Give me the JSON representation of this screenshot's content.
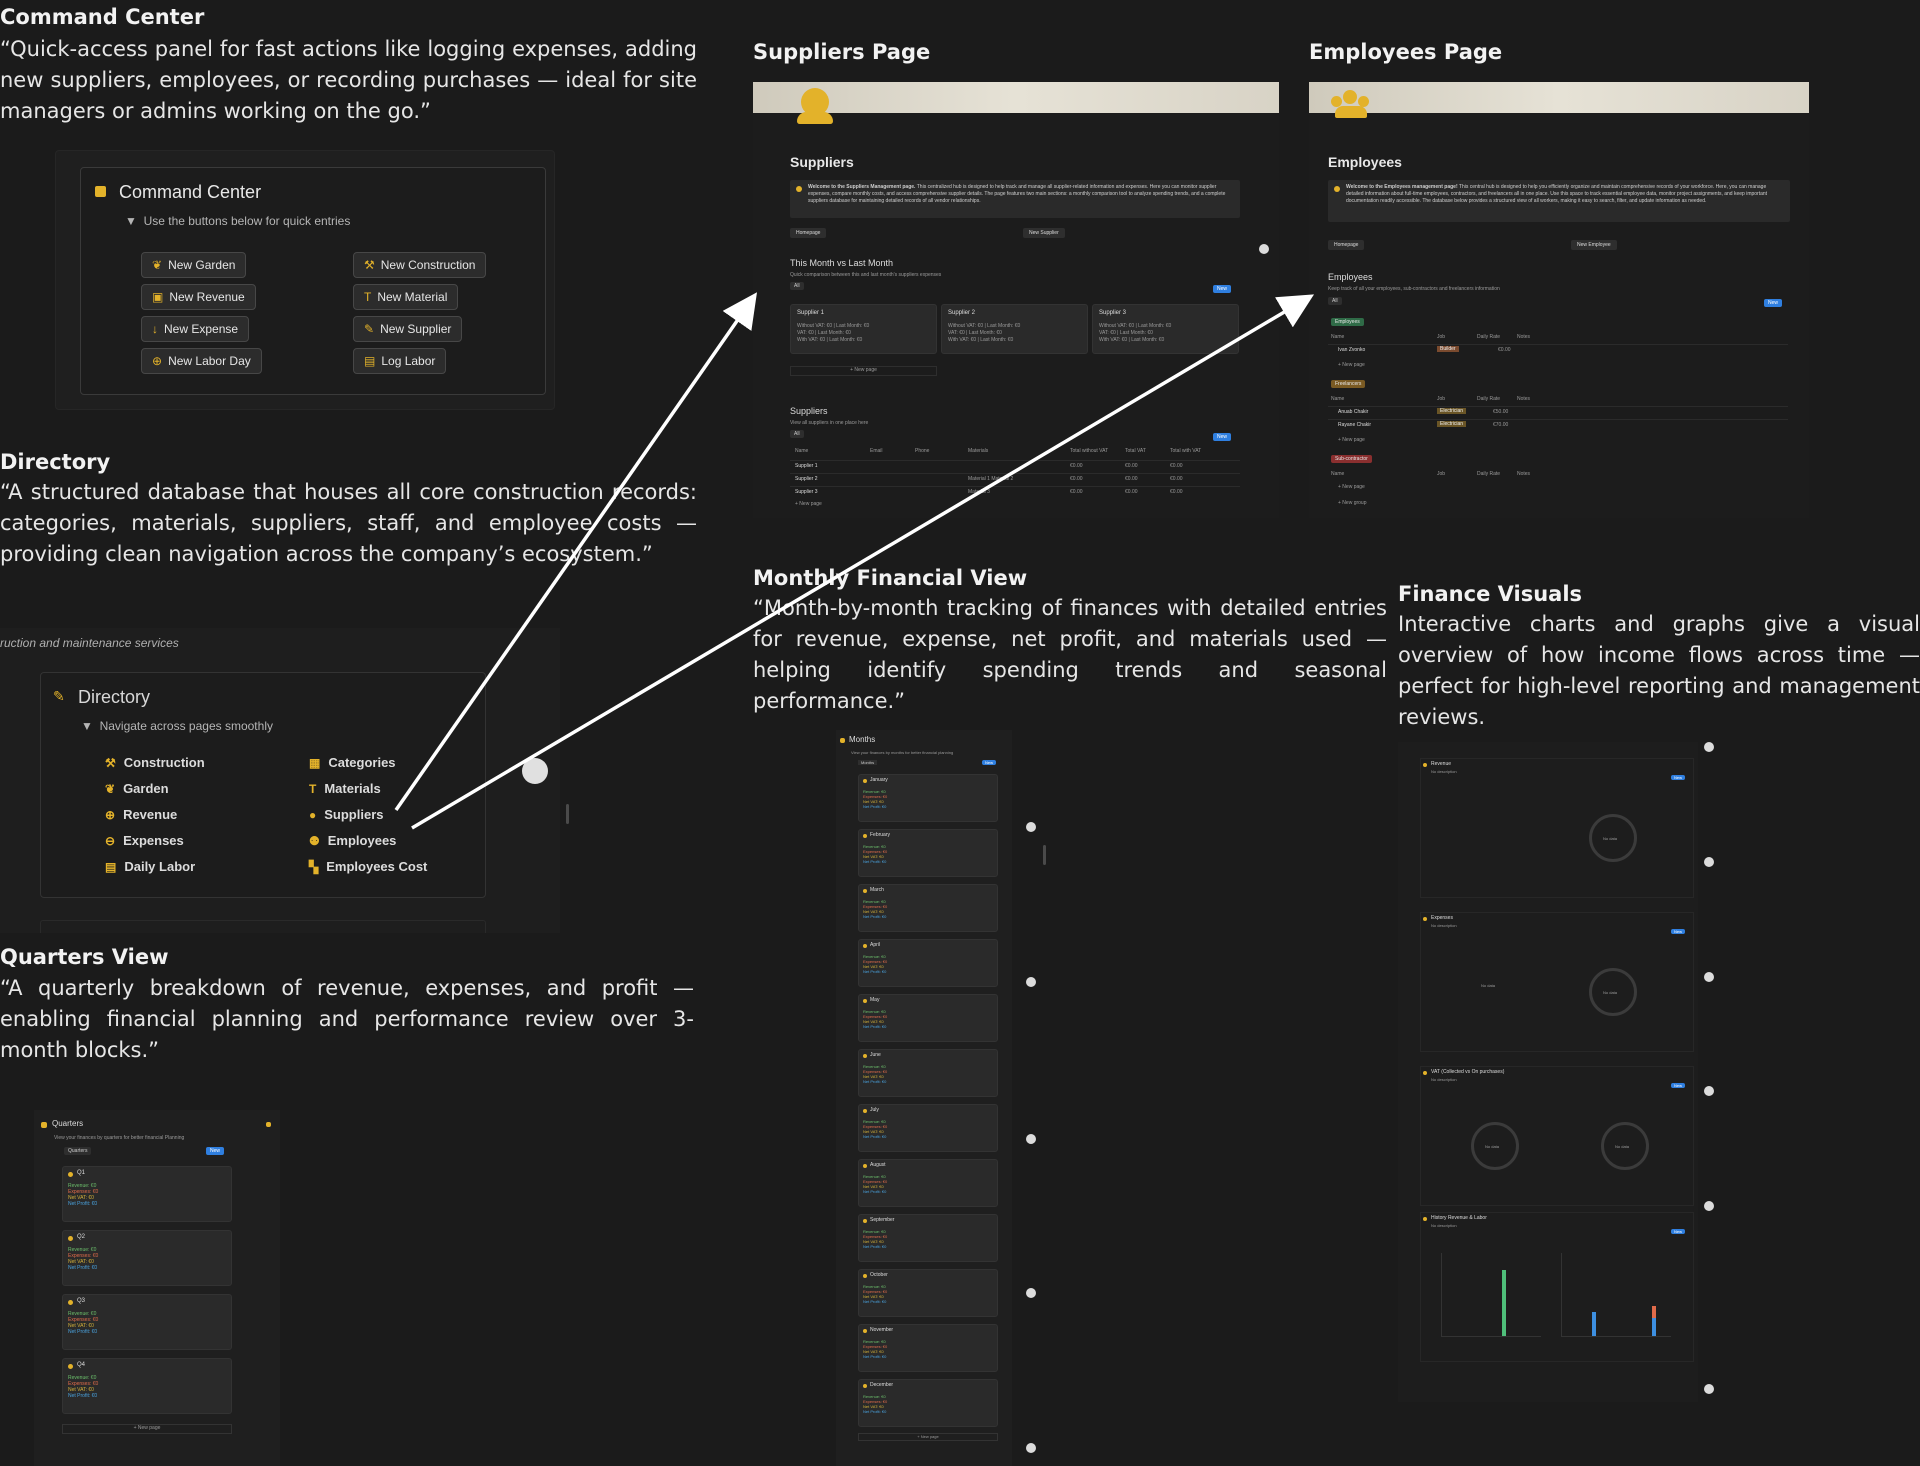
{
  "command_center": {
    "title": "Command Center",
    "description": "“Quick-access panel for fast actions like logging expenses, adding new suppliers, employees, or recording purchases — ideal for site managers or admins working on the go.”",
    "panel_title": "Command Center",
    "hint": "Use the buttons below for quick entries",
    "buttons": {
      "new_garden": "New Garden",
      "new_construction": "New Construction",
      "new_revenue": "New Revenue",
      "new_material": "New Material",
      "new_expense": "New Expense",
      "new_supplier": "New Supplier",
      "new_labor_day": "New Labor Day",
      "log_labor": "Log Labor"
    }
  },
  "directory": {
    "title": "Directory",
    "description": "“A structured database that houses all core construction records: categories, materials, suppliers, staff, and employee costs — providing clean navigation across the company’s ecosystem.”",
    "cut_header": "ruction and maintenance services",
    "panel_title": "Directory",
    "hint": "Navigate across pages smoothly",
    "items": {
      "construction": "Construction",
      "garden": "Garden",
      "revenue": "Revenue",
      "expenses": "Expenses",
      "daily_labor": "Daily Labor",
      "categories": "Categories",
      "materials": "Materials",
      "suppliers": "Suppliers",
      "employees": "Employees",
      "employees_cost": "Employees Cost"
    }
  },
  "quarters": {
    "title": "Quarters View",
    "description": "“A quarterly breakdown of revenue, expenses, and profit — enabling financial planning and performance review over 3-month blocks.”",
    "panel_title": "Quarters",
    "hint": "View your finances by quarters for better financial Planning",
    "tab": "Quarters",
    "new": "New",
    "cards": [
      "Q1",
      "Q2",
      "Q3",
      "Q4"
    ],
    "new_page": "+ New page"
  },
  "suppliers_page": {
    "title": "Suppliers Page",
    "heading": "Suppliers",
    "welcome_bold": "Welcome to the Suppliers Management page.",
    "welcome_rest": "This centralized hub is designed to help track and manage all supplier-related information and expenses. Here you can monitor supplier expenses, compare monthly costs, and access comprehensive supplier details. The page features two main sections: a monthly comparison tool to analyze spending trends, and a complete suppliers database for maintaining detailed records of all vendor relationships.",
    "homepage_btn": "Homepage",
    "new_supplier_btn": "New Supplier",
    "compare_title": "This Month vs Last Month",
    "compare_sub": "Quick comparison between this and last month's suppliers expenses",
    "all_tab": "All",
    "new": "New",
    "supplier_cards": [
      "Supplier 1",
      "Supplier 2",
      "Supplier 3"
    ],
    "card_line1": "Without VAT: €0 | Last Month: €0",
    "card_line2": "VAT: €0 | Last Month: €0",
    "card_line3": "With VAT: €0 | Last Month: €0",
    "new_page": "+ New page",
    "list_title": "Suppliers",
    "list_sub": "View all suppliers in one place here",
    "columns": [
      "Name",
      "Email",
      "Phone",
      "Materials",
      "Total without VAT",
      "Total VAT",
      "Total with VAT"
    ],
    "rows": [
      {
        "name": "Supplier 1",
        "materials": "",
        "t1": "€0.00",
        "t2": "€0.00",
        "t3": "€0.00"
      },
      {
        "name": "Supplier 2",
        "materials": "Material 1  Material 2",
        "t1": "€0.00",
        "t2": "€0.00",
        "t3": "€0.00"
      },
      {
        "name": "Supplier 3",
        "materials": "Material 3",
        "t1": "€0.00",
        "t2": "€0.00",
        "t3": "€0.00"
      }
    ]
  },
  "employees_page": {
    "title": "Employees Page",
    "heading": "Employees",
    "welcome_bold": "Welcome to the Employees management page!",
    "welcome_rest": "This central hub is designed to help you efficiently organize and maintain comprehensive records of your workforce. Here, you can manage detailed information about full-time employees, contractors, and freelancers all in one place. Use this space to track essential employee data, monitor project assignments, and keep important documentation readily accessible. The database below provides a structured view of all workers, making it easy to search, filter, and update information as needed.",
    "homepage_btn": "Homepage",
    "new_employee_btn": "New Employee",
    "list_title": "Employees",
    "list_sub": "Keep track of all your employees, sub-contractors and freelancers information",
    "all_tab": "All",
    "new": "New",
    "columns": [
      "Name",
      "Job",
      "Daily Rate",
      "Notes"
    ],
    "groups": [
      {
        "name": "Employees",
        "color": "#2f6b47",
        "rows": [
          {
            "name": "Ivan Zvonko",
            "job": "Builder",
            "rate": "€0.00"
          }
        ]
      },
      {
        "name": "Freelancers",
        "color": "#7a5a23",
        "rows": [
          {
            "name": "Anuab Chakir",
            "job": "Electrician",
            "rate": "€50.00"
          },
          {
            "name": "Rayane Chakir",
            "job": "Electrician",
            "rate": "€70.00"
          }
        ]
      },
      {
        "name": "Sub-contractor",
        "color": "#8a2f2f",
        "rows": []
      }
    ],
    "new_page": "+ New page",
    "new_group": "+ New group"
  },
  "monthly": {
    "title": "Monthly Financial View",
    "description": "“Month-by-month tracking of finances with detailed entries for revenue, expense, net profit, and materials used — helping identify spending trends and seasonal performance.”",
    "panel_title": "Months",
    "hint": "View your finances by months for better financial planning",
    "tab": "Months",
    "new": "New",
    "months": [
      "January",
      "February",
      "March",
      "April",
      "May",
      "June",
      "July",
      "August",
      "September",
      "October",
      "November",
      "December"
    ],
    "line_revenue": "Revenue: €0",
    "line_expenses": "Expenses: €0",
    "line_net": "Net VAT: €0",
    "line_profit": "Net Profit: €0",
    "new_page": "+ New page"
  },
  "visuals": {
    "title": "Finance Visuals",
    "description": "Interactive charts and graphs give a visual overview of how income flows across time — perfect for high-level reporting and management reviews.",
    "charts": [
      {
        "title": "Revenue",
        "sub": "No description"
      },
      {
        "title": "Expenses",
        "sub": "No description"
      },
      {
        "title": "VAT (Collected vs On purchases)",
        "sub": "No description"
      },
      {
        "title": "History Revenue & Labor",
        "sub": "No description"
      }
    ],
    "no_data": "No data",
    "new": "New"
  },
  "colors": {
    "accent": "#e3b22a",
    "blue": "#2f7fe0",
    "background": "#1b1b1b",
    "revenue_text": "#6bbf6b",
    "expense_text": "#e06b4a",
    "net_text": "#d4b13a",
    "profit_text": "#4aa3df"
  },
  "icons": [
    "garden-icon",
    "construction-icon",
    "revenue-icon",
    "material-icon",
    "expense-icon",
    "supplier-icon",
    "labor-day-icon",
    "log-labor-icon",
    "person-icon",
    "group-icon",
    "arrow-icon"
  ]
}
